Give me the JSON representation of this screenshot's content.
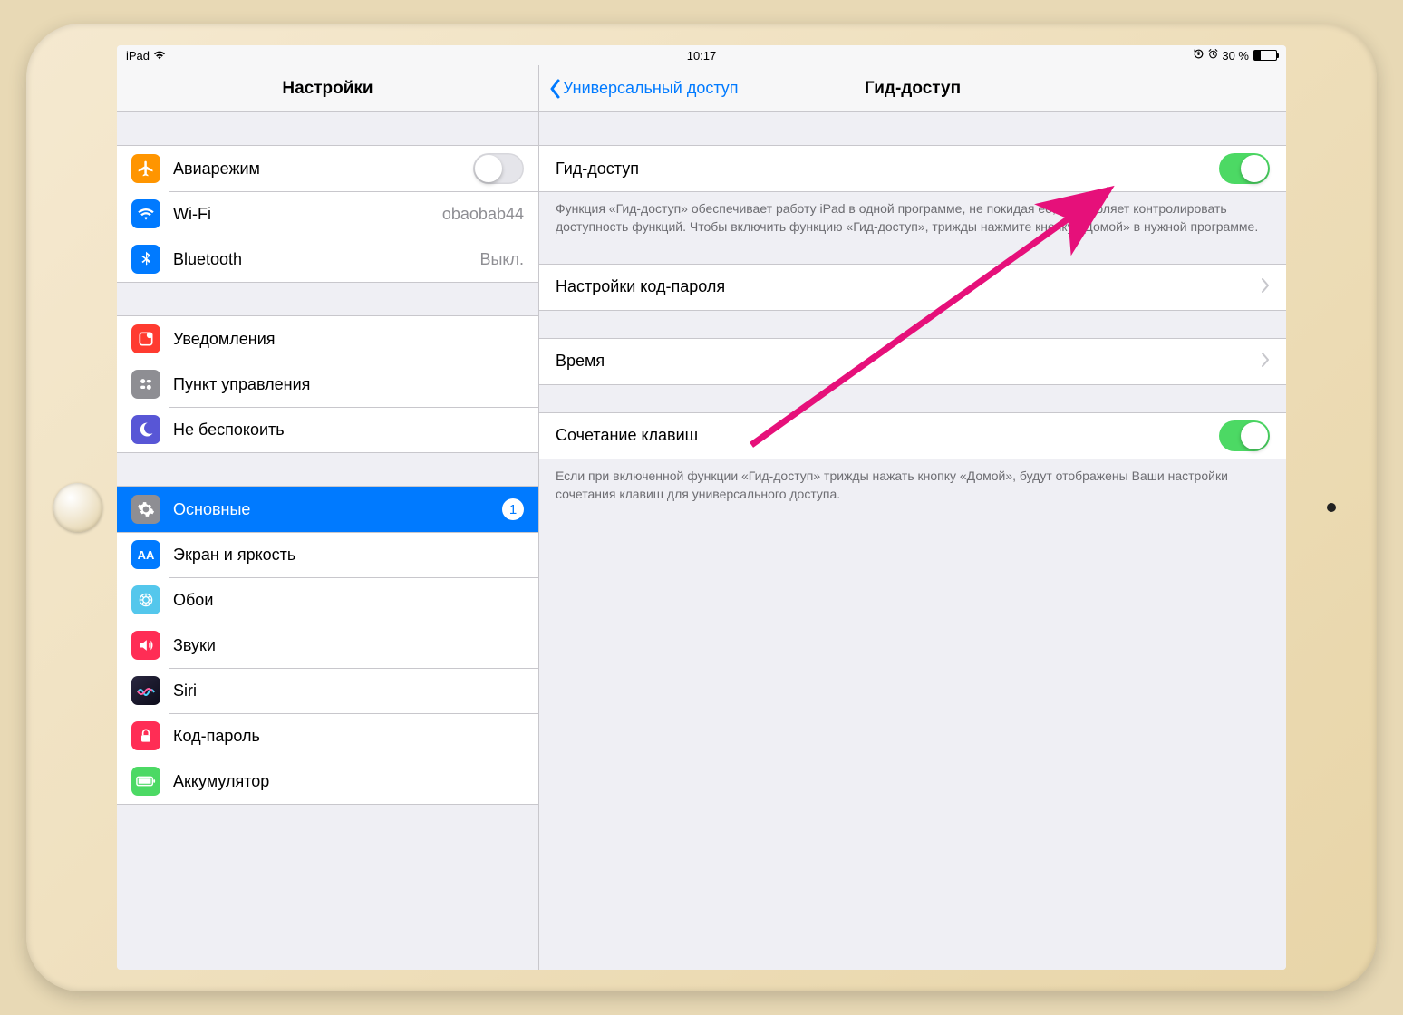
{
  "statusbar": {
    "device": "iPad",
    "time": "10:17",
    "battery_pct": "30 %"
  },
  "sidebar": {
    "title": "Настройки",
    "items": [
      {
        "label": "Авиарежим",
        "icon_color": "#ff9500",
        "switch": false
      },
      {
        "label": "Wi-Fi",
        "icon_color": "#007aff",
        "value": "obaobab44"
      },
      {
        "label": "Bluetooth",
        "icon_color": "#007aff",
        "value": "Выкл."
      },
      {
        "label": "Уведомления",
        "icon_color": "#ff3b30"
      },
      {
        "label": "Пункт управления",
        "icon_color": "#8e8e93"
      },
      {
        "label": "Не беспокоить",
        "icon_color": "#5856d6"
      },
      {
        "label": "Основные",
        "icon_color": "#8e8e93",
        "selected": true,
        "badge": "1"
      },
      {
        "label": "Экран и яркость",
        "icon_color": "#007aff"
      },
      {
        "label": "Обои",
        "icon_color": "#54c7ec"
      },
      {
        "label": "Звуки",
        "icon_color": "#ff2d55"
      },
      {
        "label": "Siri",
        "icon_color": "#1b1b2e"
      },
      {
        "label": "Код-пароль",
        "icon_color": "#ff2d55"
      },
      {
        "label": "Аккумулятор",
        "icon_color": "#4cd964"
      }
    ]
  },
  "detail": {
    "back_label": "Универсальный доступ",
    "title": "Гид-доступ",
    "rows": {
      "guided_access": {
        "label": "Гид-доступ",
        "on": true
      },
      "passcode": {
        "label": "Настройки код-пароля"
      },
      "time": {
        "label": "Время"
      },
      "shortcut": {
        "label": "Сочетание клавиш",
        "on": true
      }
    },
    "footer1": "Функция «Гид-доступ» обеспечивает работу iPad в одной программе, не покидая ее, и позволяет контролировать доступность функций. Чтобы включить функцию «Гид-доступ», трижды нажмите кнопку «Домой» в нужной программе.",
    "footer2": "Если при включенной функции «Гид-доступ» трижды нажать кнопку «Домой», будут отображены Ваши настройки сочетания клавиш для универсального доступа."
  }
}
